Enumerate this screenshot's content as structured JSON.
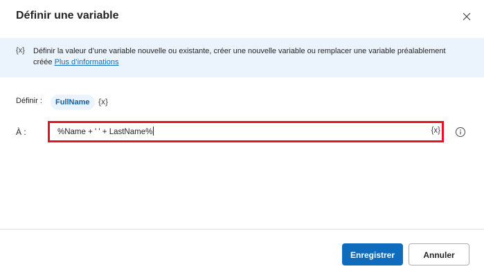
{
  "dialog": {
    "title": "Définir une variable"
  },
  "info": {
    "icon_text": "{x}",
    "text": "Définir la valeur d’une variable nouvelle ou existante, créer une nouvelle variable ou remplacer une variable préalablement créée ",
    "link": "Plus d’informations"
  },
  "form": {
    "define_label": "Définir :",
    "variable_name": "FullName",
    "variable_icon": "{x}",
    "to_label": "À :",
    "value": "%Name + ' ' + LastName%",
    "value_icon": "{x}"
  },
  "buttons": {
    "save": "Enregistrer",
    "cancel": "Annuler"
  },
  "colors": {
    "accent": "#0f6cbd",
    "banner": "#ebf3fc",
    "highlight_border": "#e81123"
  }
}
